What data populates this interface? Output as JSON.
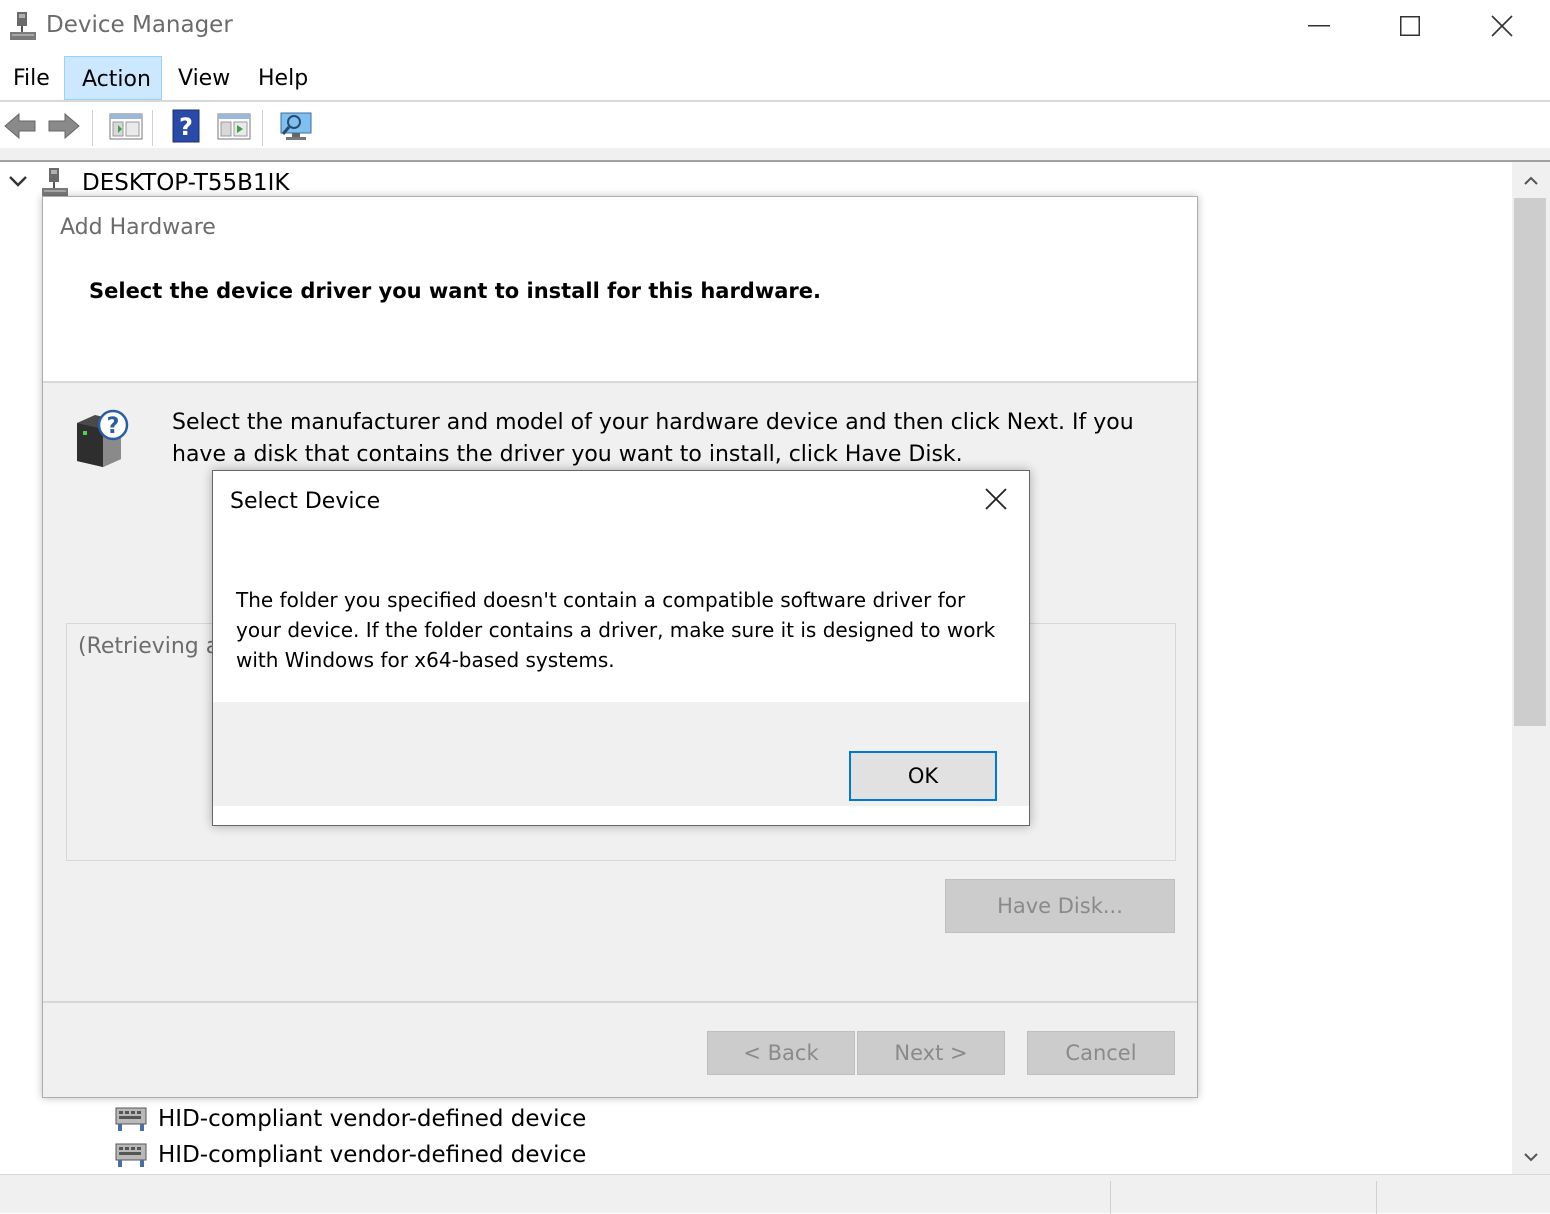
{
  "window": {
    "title": "Device Manager"
  },
  "menu": {
    "file": "File",
    "action": "Action",
    "view": "View",
    "help": "Help"
  },
  "toolbar": {
    "buttons": [
      "back-arrow-icon",
      "forward-arrow-icon",
      "properties-icon",
      "help-icon",
      "run-icon",
      "scan-hardware-icon"
    ]
  },
  "tree": {
    "root": "DESKTOP-T55B1IK",
    "items": [
      {
        "label": "HID-compliant vendor-defined device",
        "icon": "hid-device-icon"
      },
      {
        "label": "HID-compliant vendor-defined device",
        "icon": "hid-device-icon"
      }
    ]
  },
  "wizard": {
    "title": "Add Hardware",
    "header": "Select the device driver you want to install for this hardware.",
    "instructions": "Select the manufacturer and model of your hardware device and then click Next. If you have a disk that contains the driver you want to install, click Have Disk.",
    "list_status": "(Retrieving a",
    "have_disk": "Have Disk...",
    "back": "< Back",
    "next": "Next >",
    "cancel": "Cancel"
  },
  "dialog": {
    "title": "Select Device",
    "message": "The folder you specified doesn't contain a compatible software driver for your device. If the folder contains a driver, make sure it is designed to work with Windows for x64-based systems.",
    "ok": "OK"
  },
  "colors": {
    "menu_highlight": "#cce8ff",
    "accent": "#0078d7",
    "dialog_footer": "#f0f0f0",
    "disabled_button": "#cccccc"
  }
}
